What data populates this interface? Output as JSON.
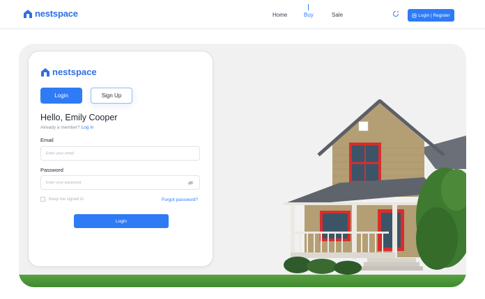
{
  "brand": {
    "name": "nestspace"
  },
  "nav": {
    "items": [
      {
        "label": "Home",
        "active": false
      },
      {
        "label": "Buy",
        "active": true
      },
      {
        "label": "Sale",
        "active": false
      }
    ],
    "login_register_label": "Login | Register"
  },
  "card": {
    "brand_name": "nestspace",
    "tabs": {
      "login": "Login",
      "signup": "Sign Up"
    },
    "greeting": "Hello, Emily Cooper",
    "member_text": "Already a member?",
    "member_link": "Log in",
    "email": {
      "label": "Email",
      "placeholder": "Enter your email"
    },
    "password": {
      "label": "Password",
      "placeholder": "Enter your password"
    },
    "keep_signed_in": "Keep me signed in",
    "forgot_password": "Forgot password?",
    "submit_label": "Login"
  },
  "colors": {
    "accent": "#2f7bf6",
    "brand": "#2f6fe4"
  }
}
